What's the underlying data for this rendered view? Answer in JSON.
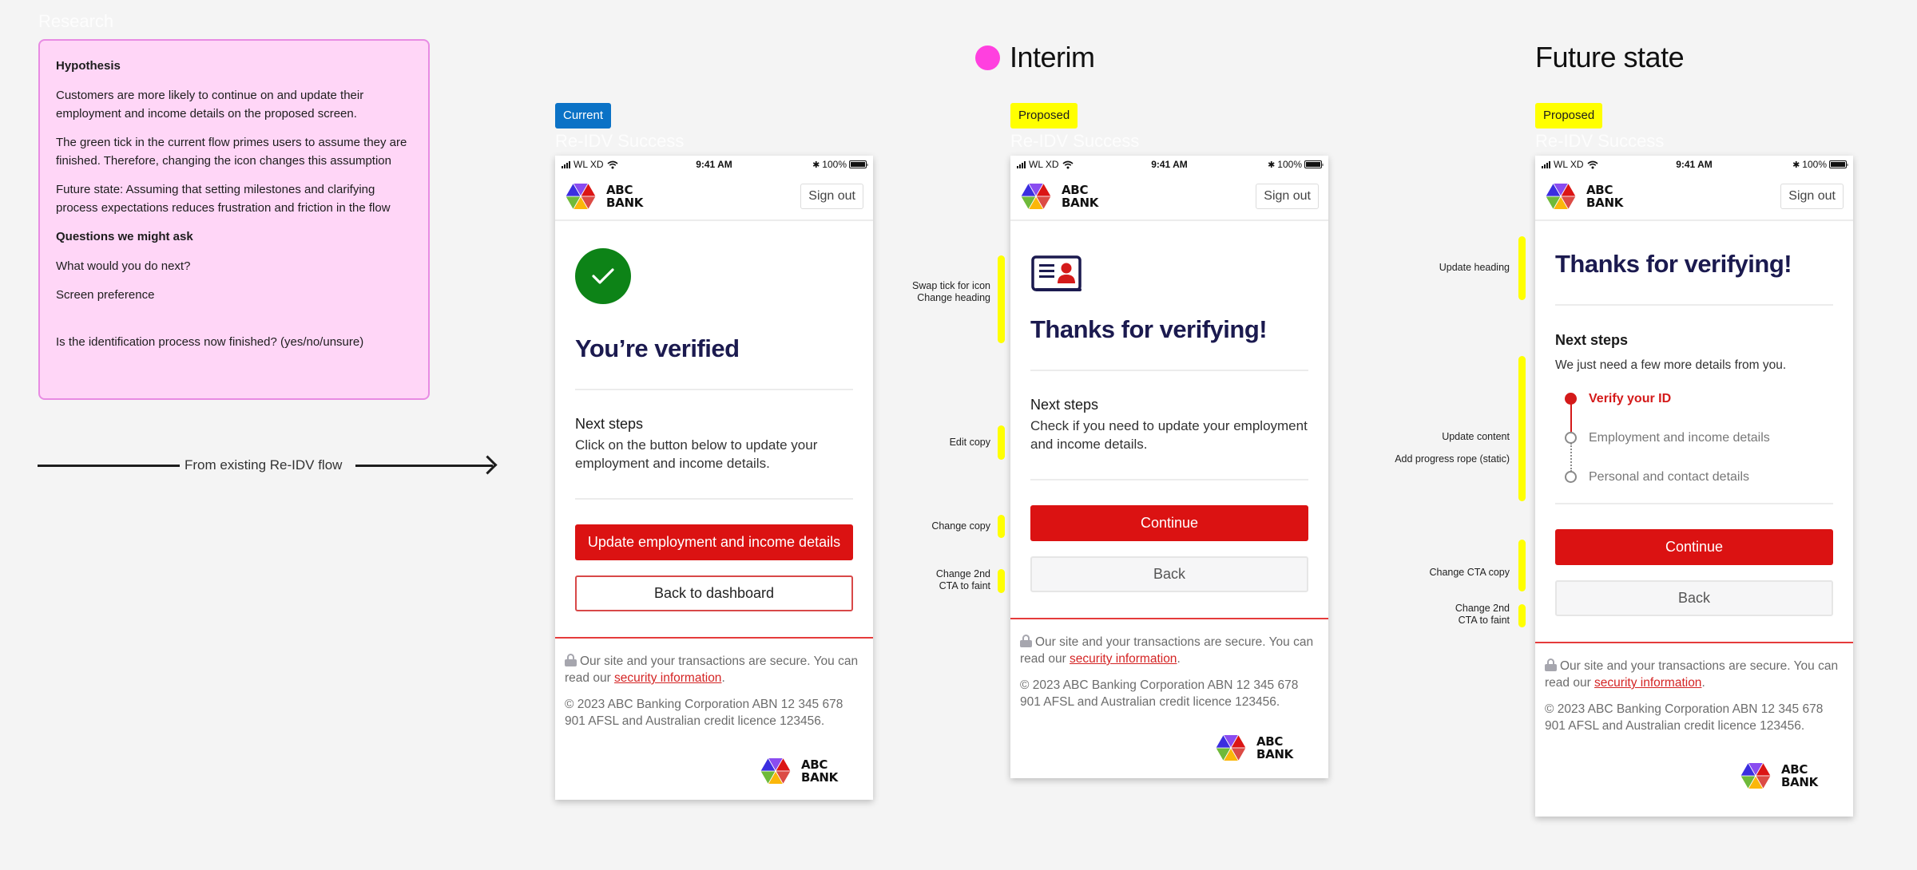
{
  "research": {
    "section_label": "Research",
    "hypothesis_title": "Hypothesis",
    "paragraphs": [
      "Customers are more likely to continue on and update their employment and income details on the proposed screen.",
      "The green tick in the current flow primes users to assume they are finished. Therefore, changing the icon changes this assumption",
      "Future state: Assuming that setting milestones and clarifying process expectations reduces frustration and friction in the flow"
    ],
    "questions_title": "Questions we might ask",
    "questions": [
      "What would you do next?",
      "Screen preference",
      "Is the identification process now finished? (yes/no/unsure)"
    ]
  },
  "flow_arrow": {
    "label": "From existing Re-IDV flow"
  },
  "columns": {
    "interim": {
      "title": "Interim",
      "dot_color": "#ff40df"
    },
    "future": {
      "title": "Future state"
    }
  },
  "status_bar": {
    "carrier": "WL XD",
    "time": "9:41 AM",
    "battery": "100%"
  },
  "brand": {
    "line1": "ABC",
    "line2": "BANK",
    "sign_out": "Sign out"
  },
  "footer": {
    "secure_text": "Our site and your transactions are secure. You can read our ",
    "secure_link": "security information",
    "secure_end": ".",
    "copyright": "© 2023 ABC Banking Corporation ABN 12 345 678 901 AFSL and Australian credit licence 123456."
  },
  "screens": [
    {
      "badge": "Current",
      "badge_color": "#0b72c6",
      "label": "Re-IDV Success",
      "icon": "green-check-icon",
      "heading": "You’re verified",
      "next_steps_title": "Next steps",
      "next_steps_body": "Click on the button below to update your employment and income details.",
      "primary_cta": "Update employment and income details",
      "secondary_cta": "Back to dashboard"
    },
    {
      "badge": "Proposed",
      "badge_color": "#ffff00",
      "label": "Re-IDV Success",
      "icon": "id-card-icon",
      "heading": "Thanks for verifying!",
      "next_steps_title": "Next steps",
      "next_steps_body": "Check if you need to update your employment and income details.",
      "primary_cta": "Continue",
      "secondary_cta": "Back",
      "annotations": [
        "Swap tick for icon\nChange heading",
        "Edit copy",
        "Change copy",
        "Change 2nd\nCTA to faint"
      ]
    },
    {
      "badge": "Proposed",
      "badge_color": "#ffff00",
      "label": "Re-IDV Success",
      "heading": "Thanks for verifying!",
      "next_steps_title": "Next steps",
      "next_steps_body": "We just need a few more details from you.",
      "steps": [
        {
          "label": "Verify your ID",
          "state": "active"
        },
        {
          "label": "Employment and income details",
          "state": "pending"
        },
        {
          "label": "Personal and contact details",
          "state": "pending"
        }
      ],
      "primary_cta": "Continue",
      "secondary_cta": "Back",
      "annotations": [
        "Update heading",
        "Update content",
        "Add progress rope (static)",
        "Change CTA copy",
        "Change 2nd\nCTA to faint"
      ]
    }
  ]
}
